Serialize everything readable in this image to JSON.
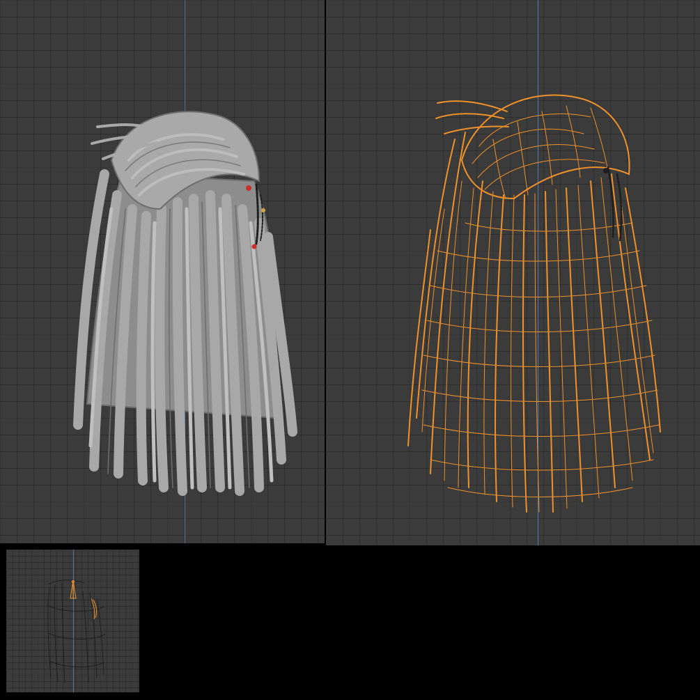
{
  "layout": {
    "viewports": [
      {
        "id": "solid",
        "shading": "solid"
      },
      {
        "id": "wireframe",
        "shading": "wireframe"
      },
      {
        "id": "thumbnail",
        "shading": "wireframe"
      }
    ]
  },
  "colors": {
    "viewport_bg": "#3b3b3b",
    "axis_line": "#5479a8",
    "solid_hair": "#a9a9a9",
    "solid_hair_shadow": "#6e6e6e",
    "wire_selected": "#f0922b",
    "accessory_red": "#c9312b",
    "accessory_metal": "#1e1e1e"
  },
  "icons": {
    "model": "hair-mesh",
    "accessory": "hair-chain-ornament"
  }
}
